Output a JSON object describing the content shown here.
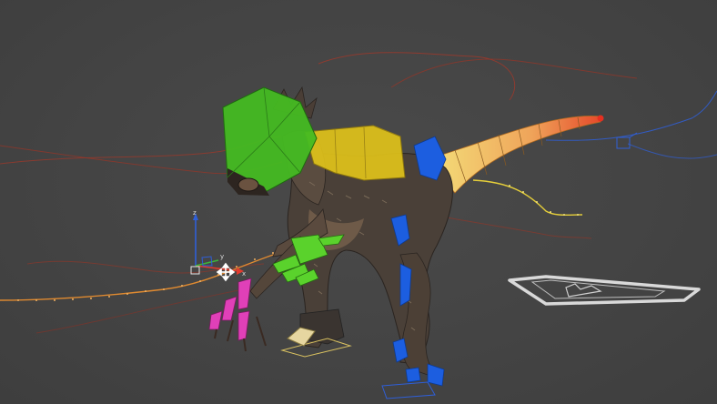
{
  "viewport": {
    "gizmo": {
      "axis_x_label": "x",
      "axis_y_label": "y",
      "axis_z_label": "z",
      "colors": {
        "x": "#e23b2e",
        "y": "#3cb43c",
        "z": "#2f5fd8"
      }
    }
  },
  "colors": {
    "background": "#444444",
    "head_control": "#44bb22",
    "body_control": "#e0c21a",
    "tail_gradient": [
      "#f4d27a",
      "#e64a2a"
    ],
    "left_hand_control": "#5ad22c",
    "right_hand_control": "#e040b8",
    "leg_control": "#1c5ee0",
    "motion_path_red": "#b03a2a",
    "motion_path_orange": "#e08a30",
    "motion_path_yellow": "#e6cf3a",
    "root_control": "#d9d9d9"
  }
}
